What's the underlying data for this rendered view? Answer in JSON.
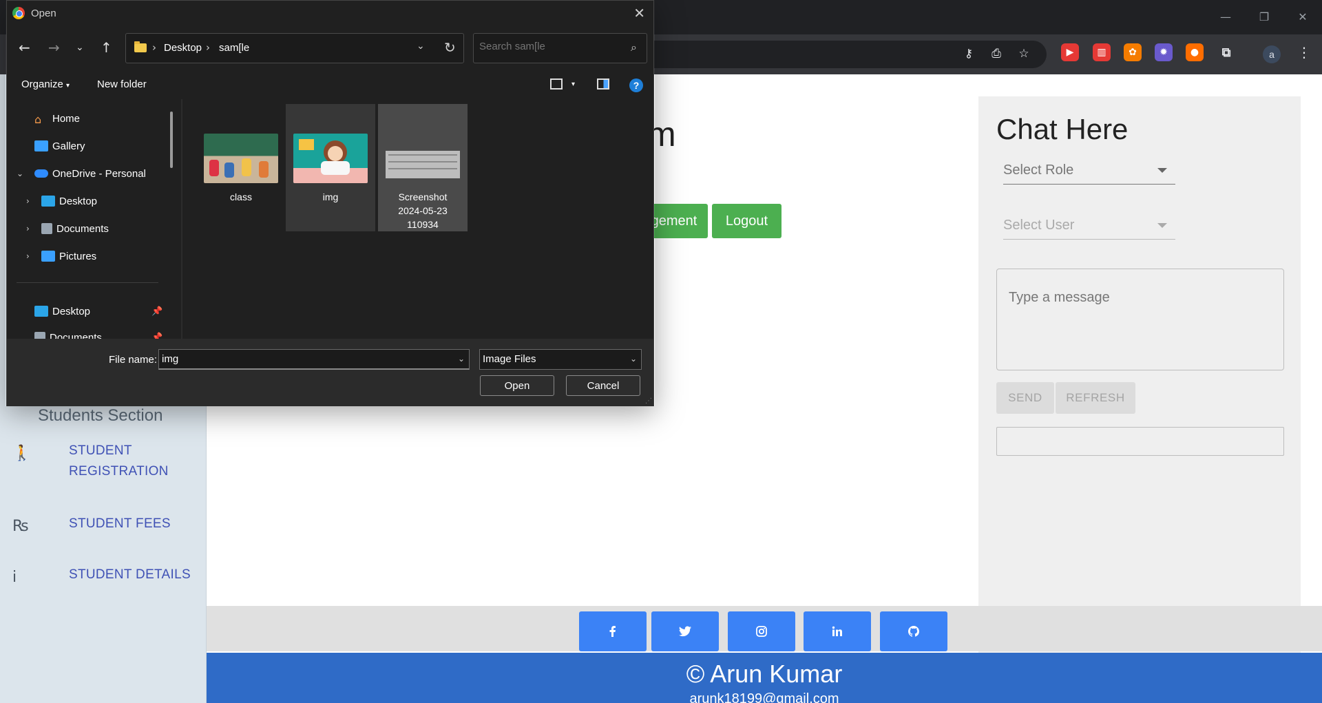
{
  "browser": {
    "window_controls": [
      "—",
      "❐",
      "✕"
    ],
    "extensions": [
      {
        "name": "youtube-ext-icon",
        "color": "#e53935",
        "glyph": "▶"
      },
      {
        "name": "audio-ext-icon",
        "color": "#e53935",
        "glyph": "▥"
      },
      {
        "name": "film-ext-icon",
        "color": "#f57c00",
        "glyph": "✿"
      },
      {
        "name": "purple-ext-icon",
        "color": "#6a5acd",
        "glyph": "✹"
      },
      {
        "name": "orange-ext-icon",
        "color": "#ff6d00",
        "glyph": "●"
      }
    ],
    "profile_initial": "a"
  },
  "page": {
    "title_fragment": "m",
    "buttons": {
      "management_fragment": "gement",
      "logout": "Logout"
    },
    "sidebar": {
      "section_title": "Students Section",
      "items": [
        {
          "icon": "🚶",
          "label": "STUDENT REGISTRATION"
        },
        {
          "icon": "₨",
          "label": "STUDENT FEES"
        },
        {
          "icon": "i",
          "label": "STUDENT DETAILS"
        }
      ]
    },
    "chat": {
      "title": "Chat Here",
      "select_role": "Select Role",
      "select_user": "Select User",
      "message_placeholder": "Type a message",
      "send": "SEND",
      "refresh": "REFRESH"
    },
    "footer": {
      "name": "© Arun Kumar",
      "email": "arunk18199@gmail.com",
      "social": [
        "f",
        "🐦",
        "◎",
        "in",
        "⌥"
      ]
    }
  },
  "dialog": {
    "title": "Open",
    "breadcrumb": [
      "Desktop",
      "sam[le"
    ],
    "search_placeholder": "Search sam[le",
    "organize": "Organize",
    "new_folder": "New folder",
    "help": "?",
    "nav": {
      "home": "Home",
      "gallery": "Gallery",
      "onedrive": "OneDrive - Personal",
      "desktop": "Desktop",
      "documents": "Documents",
      "pictures": "Pictures",
      "quick_desktop": "Desktop",
      "quick_documents": "Documents"
    },
    "files": [
      {
        "name": "class"
      },
      {
        "name": "img"
      },
      {
        "name": "Screenshot 2024-05-23 110934"
      }
    ],
    "file_name_label": "File name:",
    "file_name_value": "img",
    "file_type": "Image Files",
    "open": "Open",
    "cancel": "Cancel"
  }
}
